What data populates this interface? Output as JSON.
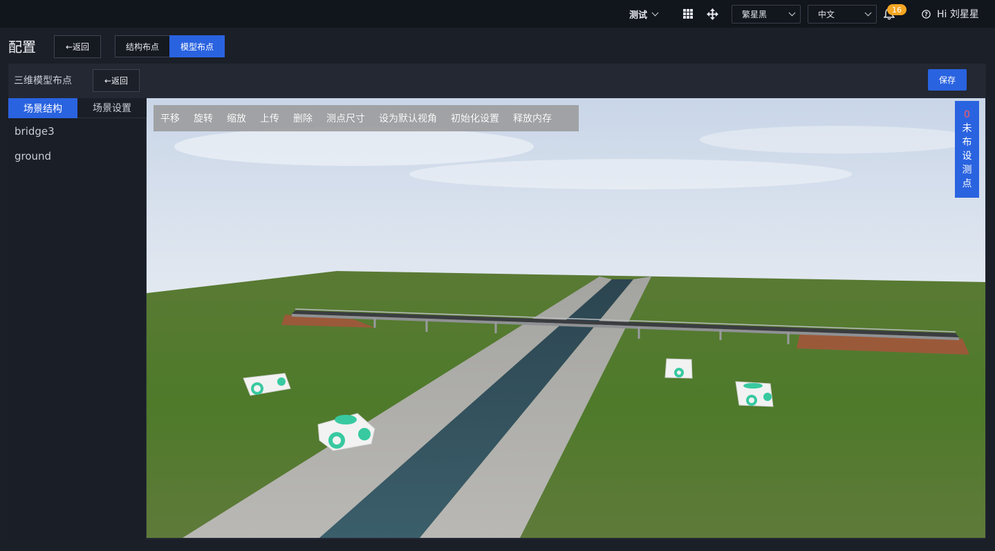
{
  "topbar": {
    "project": "测试",
    "theme_select": "繁星黑",
    "lang_select": "中文",
    "notif_count": "16",
    "greeting": "Hi 刘星星"
  },
  "header": {
    "title": "配置",
    "back": "←返回",
    "tabs": [
      {
        "label": "结构布点",
        "active": false
      },
      {
        "label": "模型布点",
        "active": true
      }
    ]
  },
  "panel": {
    "title": "三维模型布点",
    "back": "←返回",
    "save": "保存"
  },
  "sidebar": {
    "tabs": [
      {
        "label": "场景结构",
        "active": true
      },
      {
        "label": "场景设置",
        "active": false
      }
    ],
    "items": [
      "bridge3",
      "ground"
    ]
  },
  "toolbar": {
    "tools": [
      "平移",
      "旋转",
      "缩放",
      "上传",
      "删除",
      "测点尺寸",
      "设为默认视角",
      "初始化设置",
      "释放内存"
    ]
  },
  "unplaced": {
    "count": "0",
    "label": "未布设测点"
  },
  "colors": {
    "accent": "#2a63e0",
    "badge": "#f5a623",
    "count": "#ff5a5a"
  }
}
